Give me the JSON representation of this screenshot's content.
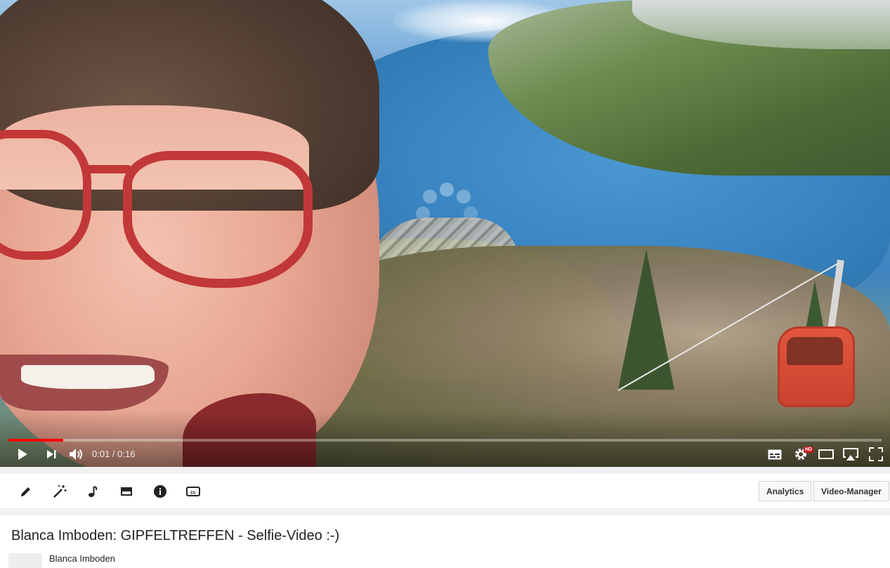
{
  "player": {
    "current_time": "0:01",
    "separator": " / ",
    "duration": "0:16",
    "progress_fraction": 0.0625,
    "controls": [
      "play-icon",
      "next-icon",
      "volume-icon",
      "subtitles-icon",
      "settings-icon",
      "theater-icon",
      "airplay-icon",
      "fullscreen-icon"
    ],
    "hd_badge": "HD",
    "progress_color": "#ff0000"
  },
  "toolbar": {
    "tools": [
      "pencil-icon",
      "magic-wand-icon",
      "music-note-icon",
      "card-icon",
      "info-icon",
      "cc-icon"
    ],
    "analytics_label": "Analytics",
    "video_manager_label": "Video-Manager"
  },
  "video": {
    "title": "Blanca Imboden: GIPFELTREFFEN - Selfie-Video :-)",
    "channel": "Blanca Imboden"
  }
}
